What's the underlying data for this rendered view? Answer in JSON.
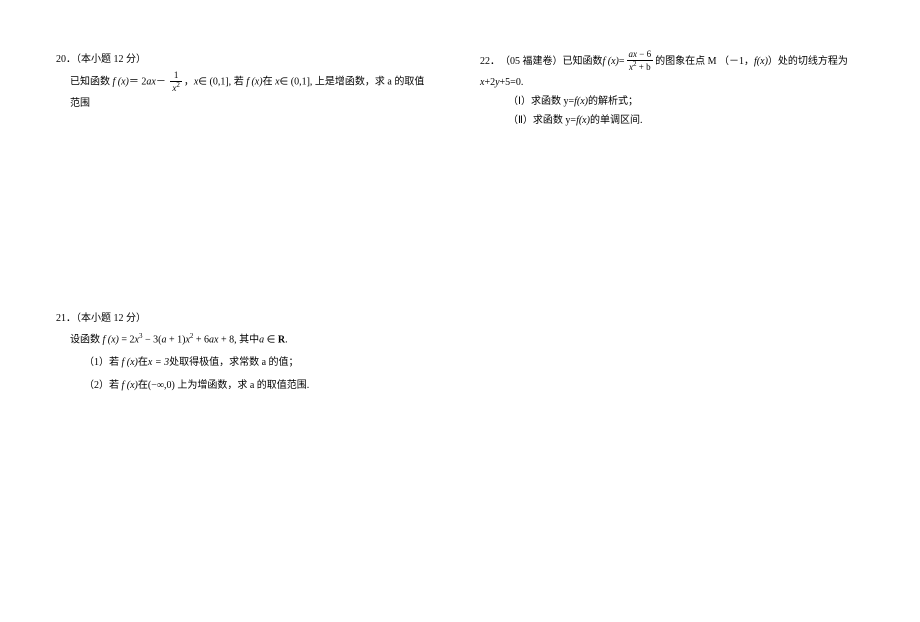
{
  "p20": {
    "number": "20．",
    "points": "（本小题 12 分）",
    "line1_a": "已知函数 ",
    "fx": "f (x)",
    "eq": "＝",
    "term1_a": "2",
    "term1_b": "ax",
    "minus": "－",
    "frac_num": "1",
    "frac_den_a": "x",
    "frac_den_exp": "2",
    "comma_x": "，",
    "x_in": "x",
    "in_sym": "∈",
    "interval": " (0,1], ",
    "ruo": "若 ",
    "zai": "在 ",
    "shang": "上是增函数，求 a 的取值范围"
  },
  "p21": {
    "number": "21．",
    "points": "（本小题 12 分）",
    "line1_a": "设函数 ",
    "fx": "f (x) ",
    "eq": "= 2",
    "x3_base": "x",
    "x3_exp": "3",
    "minus1": " − 3(",
    "a": "a",
    "plus1": " + 1)",
    "x2_base": "x",
    "x2_exp": "2",
    "plus2": " + 6",
    "ax": "ax",
    "plus8": " + 8, ",
    "qizhong": "其中",
    "a_in": "a ",
    "in_sym": "∈",
    "R": " R",
    "period": ".",
    "sub1": "（1）若 ",
    "sub1_fx": "f (x)",
    "sub1_zai": "在",
    "sub1_x3": "x = 3",
    "sub1_rest": "处取得极值，求常数 a 的值；",
    "sub2": "（2）若 ",
    "sub2_fx": "f (x)",
    "sub2_zai": "在",
    "sub2_int": "(−∞,0)",
    "sub2_rest": " 上为增函数，求 a 的取值范围."
  },
  "p22": {
    "number": "22．",
    "source": "（05 福建卷）已知函数 ",
    "fx": "f (x) ",
    "eq": "=",
    "frac_num_a": "ax ",
    "frac_num_b": "− 6",
    "frac_den_a": "x",
    "frac_den_exp": "2",
    "frac_den_b": " + b",
    "line1_rest": " 的图象在点 M （－1，",
    "fx2": "f(x)",
    "line1_end": "）处的切线方程为",
    "line2_a": "x",
    "line2_b": "+2",
    "line2_c": "y",
    "line2_d": "+5=0.",
    "sub1": "（Ⅰ）求函数 y=",
    "sub1_fx": "f(x)",
    "sub1_end": "的解析式；",
    "sub2": "（Ⅱ）求函数 y=",
    "sub2_fx": "f(x)",
    "sub2_end": "的单调区间."
  }
}
